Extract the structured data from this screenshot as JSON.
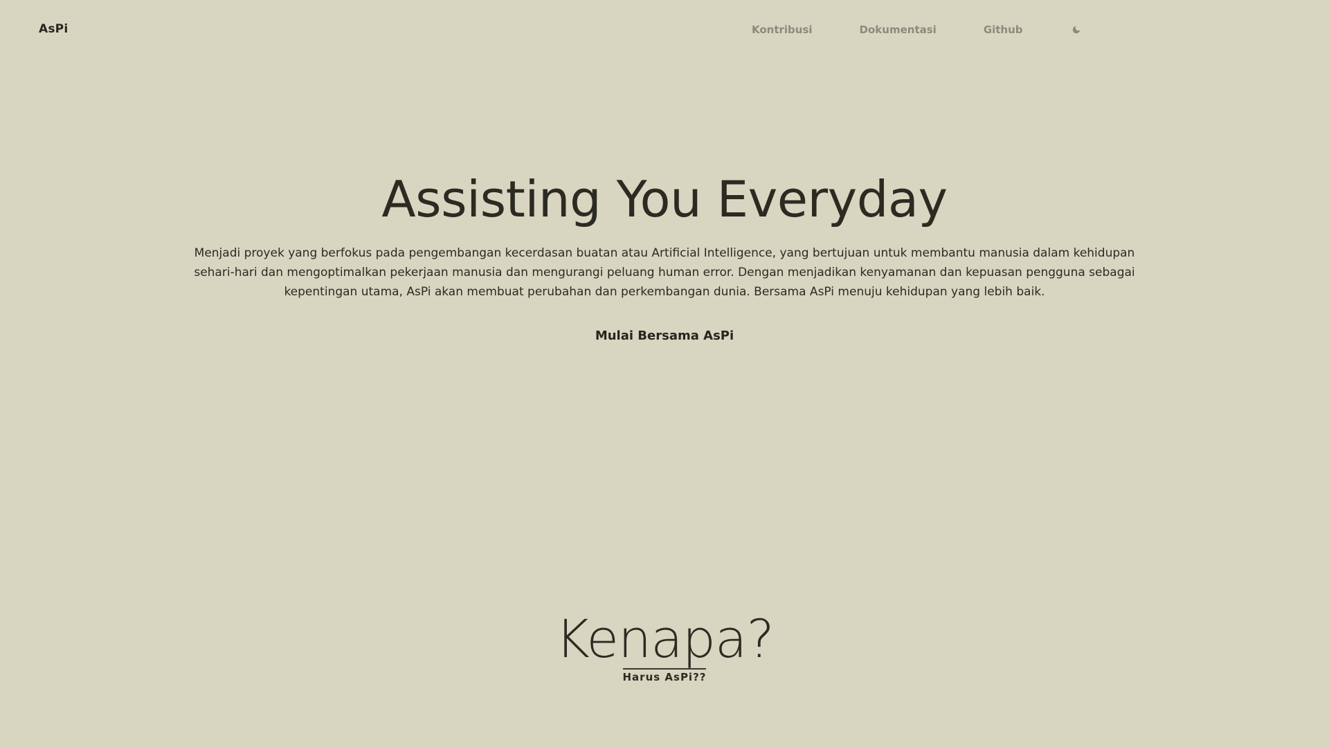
{
  "nav": {
    "brand": "AsPi",
    "links": [
      {
        "label": "Kontribusi"
      },
      {
        "label": "Dokumentasi"
      },
      {
        "label": "Github"
      }
    ],
    "theme_toggle_icon": "moon-icon"
  },
  "hero": {
    "title": "Assisting You Everyday",
    "description": "Menjadi proyek yang berfokus pada pengembangan kecerdasan buatan atau Artificial Intelligence, yang bertujuan untuk membantu manusia dalam kehidupan sehari-hari dan mengoptimalkan pekerjaan manusia dan mengurangi peluang human error. Dengan menjadikan kenyamanan dan kepuasan pengguna sebagai kepentingan utama, AsPi akan membuat perubahan dan perkembangan dunia. Bersama AsPi menuju kehidupan yang lebih baik.",
    "cta": "Mulai Bersama AsPi"
  },
  "why": {
    "title": "Kenapa?",
    "subtitle": "Harus AsPi??"
  },
  "colors": {
    "background": "#d8d5c1",
    "text": "#2b2b22",
    "nav_link": "#8d8a7c"
  }
}
